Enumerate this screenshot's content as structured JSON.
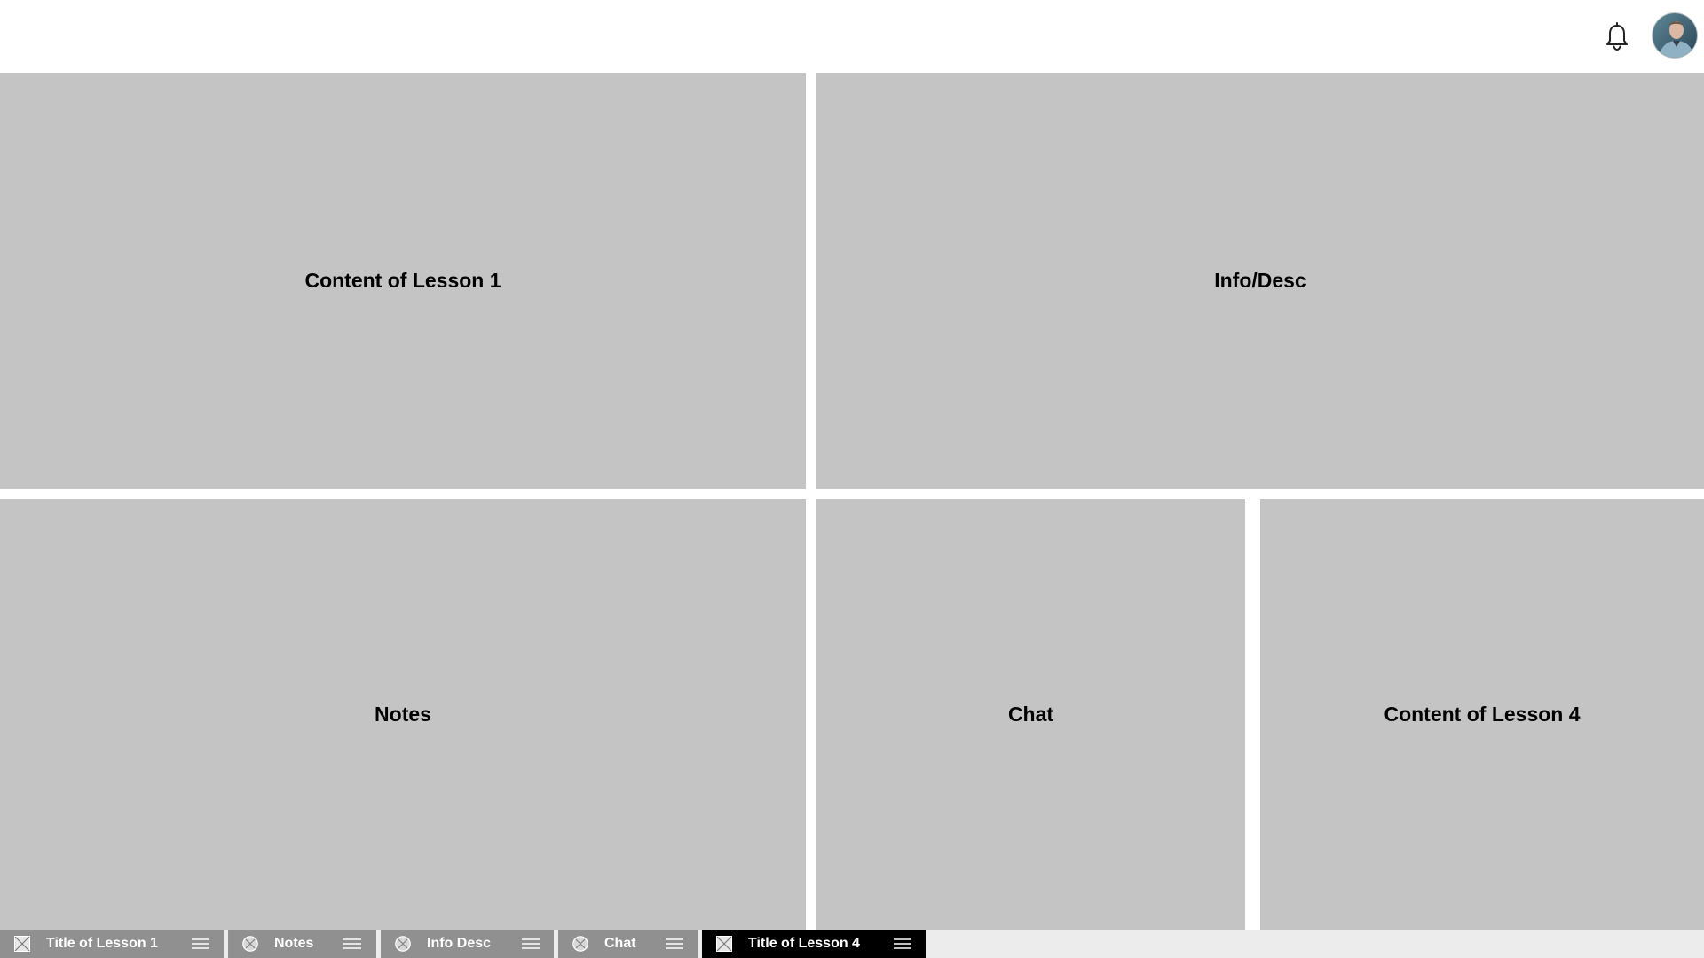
{
  "header": {
    "bell_icon": "bell-icon",
    "avatar": "user-avatar"
  },
  "panels": [
    {
      "title": "Content of Lesson 1"
    },
    {
      "title": "Info/Desc"
    },
    {
      "title": "Notes"
    },
    {
      "title": "Chat"
    },
    {
      "title": "Content of Lesson 4"
    }
  ],
  "tabs": [
    {
      "label": "Title of Lesson 1",
      "icon": "image-placeholder-icon",
      "active": false
    },
    {
      "label": "Notes",
      "icon": "circle-x-icon",
      "active": false
    },
    {
      "label": "Info Desc",
      "icon": "circle-x-icon",
      "active": false
    },
    {
      "label": "Chat",
      "icon": "circle-x-icon",
      "active": false
    },
    {
      "label": "Title of Lesson 4",
      "icon": "image-placeholder-icon",
      "active": true
    }
  ],
  "colors": {
    "panel_bg": "#c4c4c4",
    "tab_bg": "#909090",
    "tab_active_bg": "#000000",
    "tabbar_bg": "#ececec"
  }
}
